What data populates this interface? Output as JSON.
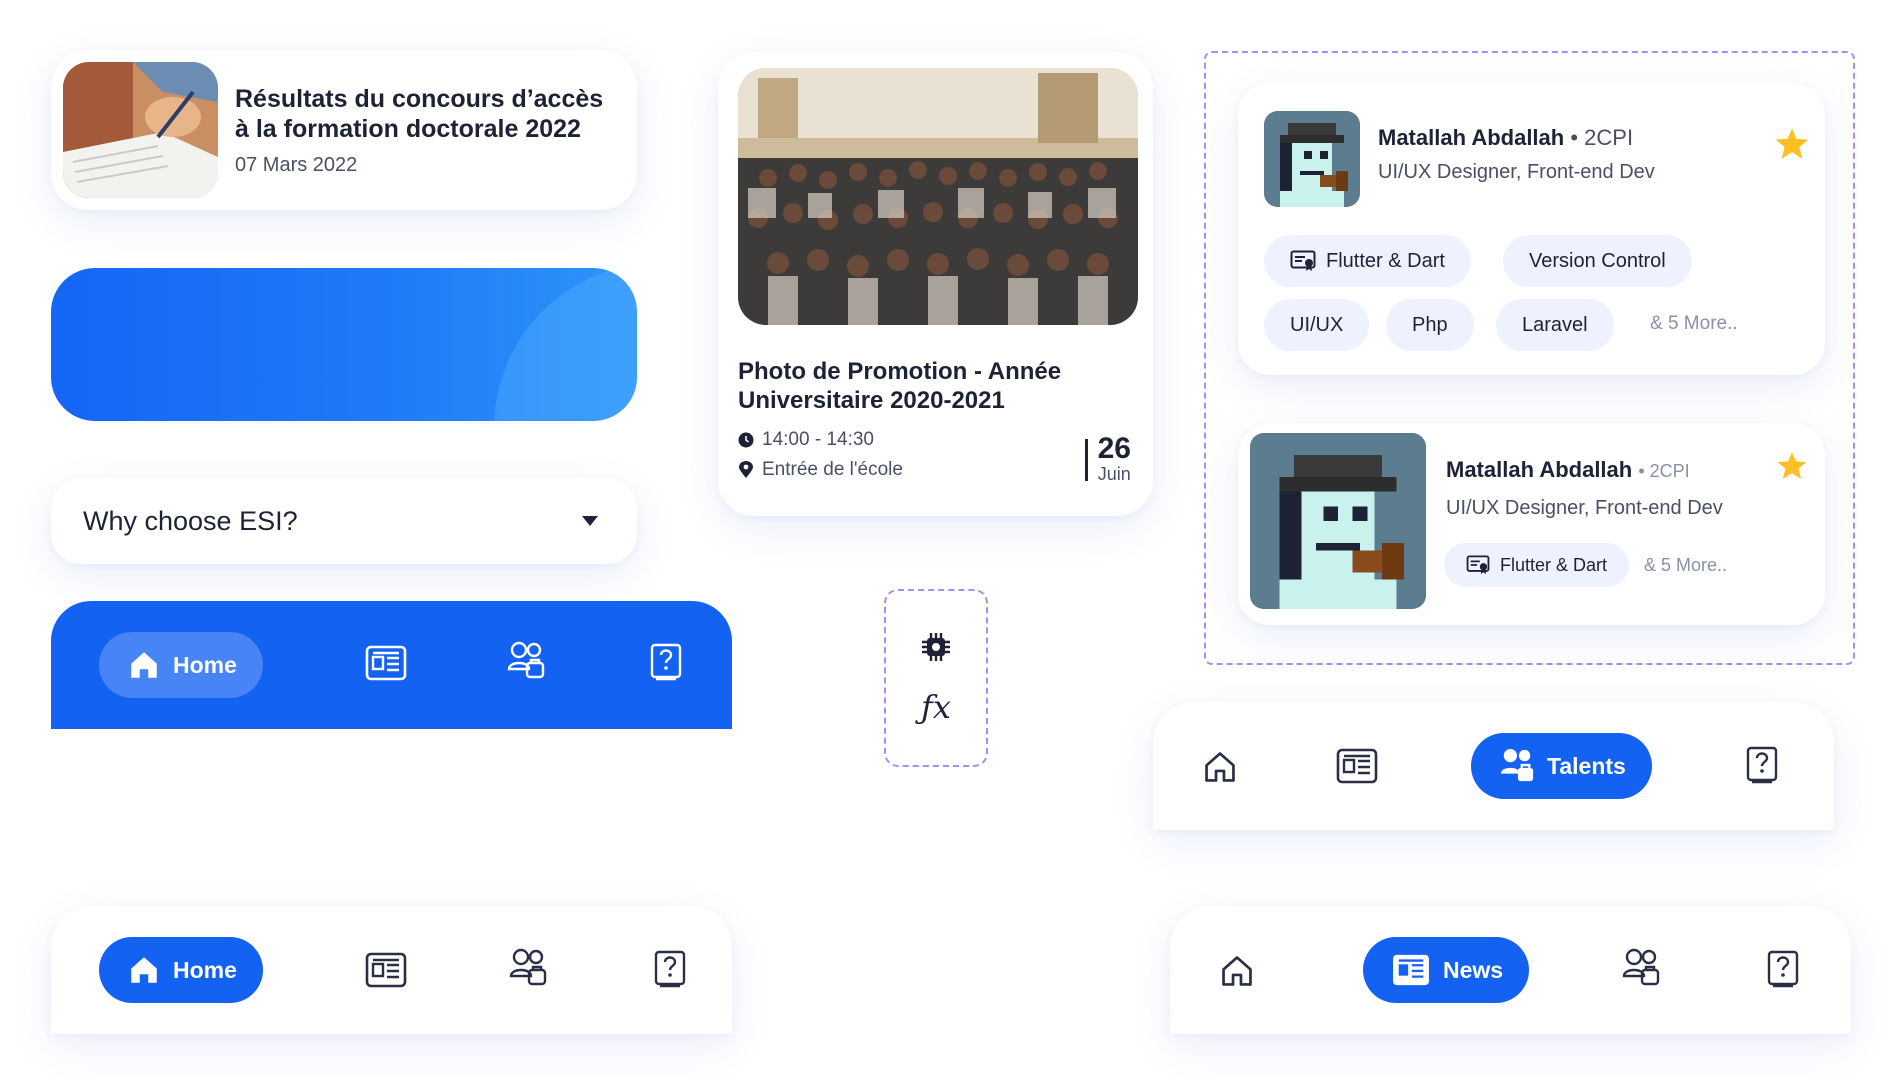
{
  "news": {
    "title": "Résultats du concours d’accès à la formation doctorale 2022",
    "date": "07 Mars 2022"
  },
  "faq": {
    "question": "Why choose ESI?"
  },
  "nav_labels": {
    "home": "Home",
    "news": "News",
    "talents": "Talents"
  },
  "event": {
    "title": "Photo de Promotion - Année Universitaire 2020-2021",
    "time": "14:00 - 14:30",
    "location": "Entrée de l'école",
    "day": "26",
    "month": "Juin"
  },
  "talents": [
    {
      "name": "Matallah Abdallah",
      "level": "• 2CPI",
      "role": "UI/UX Designer, Front-end Dev",
      "skills": [
        "Flutter & Dart",
        "Version Control",
        "UI/UX",
        "Php",
        "Laravel"
      ],
      "more": "& 5 More.."
    },
    {
      "name": "Matallah Abdallah",
      "level": "• 2CPI",
      "role": "UI/UX Designer, Front-end Dev",
      "skills": [
        "Flutter & Dart"
      ],
      "more": "& 5 More.."
    }
  ],
  "colors": {
    "primary": "#1462f2",
    "text": "#1e2235",
    "muted": "#4a4f63",
    "chip_bg": "#eef2ff",
    "star": "#fbbf24",
    "dashed_border": "#a78bfa"
  },
  "icons": [
    "home-icon",
    "news-icon",
    "talents-icon",
    "help-icon",
    "clock-icon",
    "location-icon",
    "star-icon",
    "chevron-down-icon",
    "chip-icon",
    "function-icon",
    "certificate-icon"
  ]
}
